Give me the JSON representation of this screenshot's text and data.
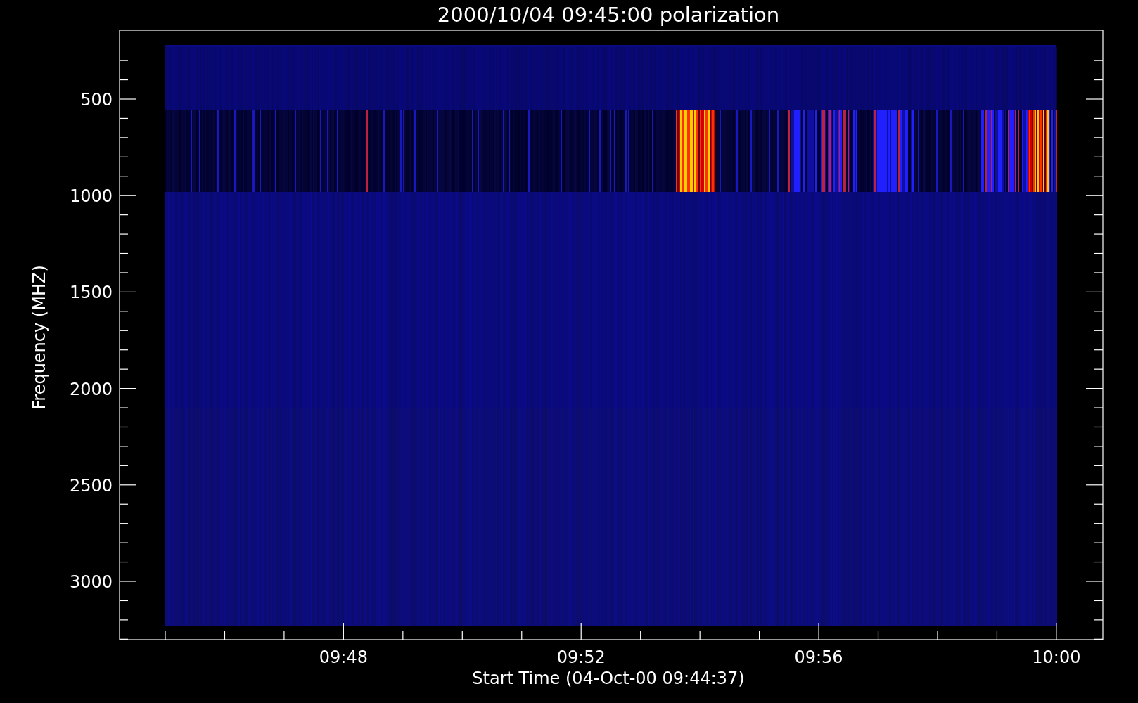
{
  "plot": {
    "title": "2000/10/04 09:45:00 polarization",
    "ylabel": "Frequency (MHZ)",
    "xlabel": "Start Time (04-Oct-00 09:44:37)",
    "yticks": [
      "500",
      "1000",
      "1500",
      "2000",
      "2500",
      "3000"
    ],
    "xticks": [
      "09:48",
      "09:52",
      "09:56",
      "10:00"
    ]
  }
}
